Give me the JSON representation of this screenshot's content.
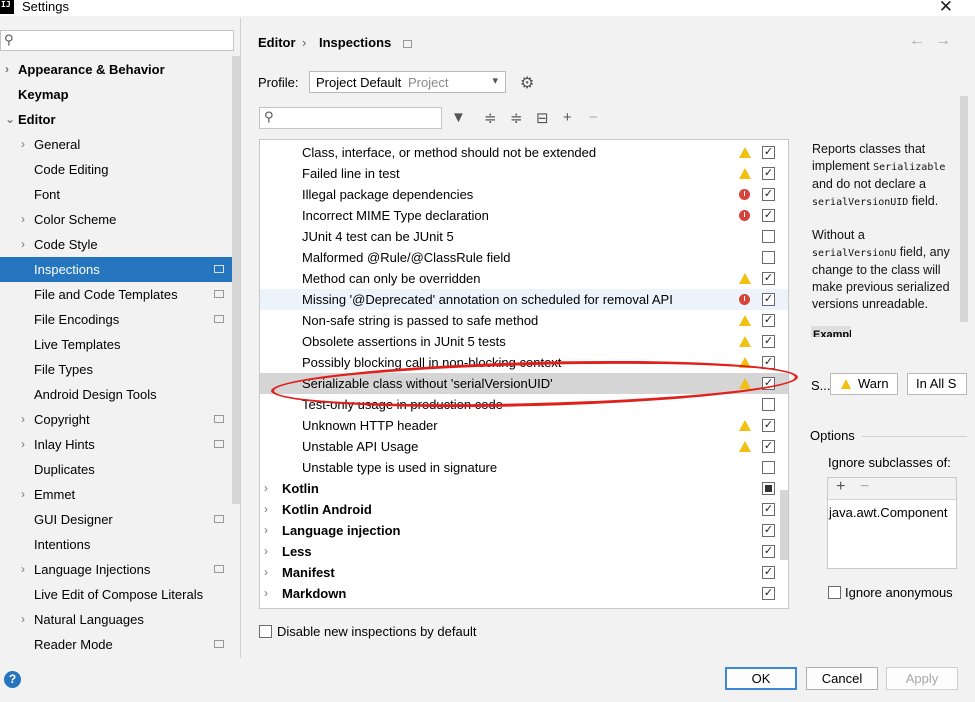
{
  "window": {
    "title": "Settings",
    "app_icon_text": "IJ"
  },
  "sidebar": {
    "search_placeholder": "",
    "items": [
      {
        "label": "Appearance & Behavior",
        "bold": true,
        "chevron": true,
        "indent": 0
      },
      {
        "label": "Keymap",
        "bold": true,
        "chevron": false,
        "indent": 0
      },
      {
        "label": "Editor",
        "bold": true,
        "chevron": true,
        "expanded": true,
        "indent": 0
      },
      {
        "label": "General",
        "chevron": true,
        "indent": 1
      },
      {
        "label": "Code Editing",
        "chevron": false,
        "indent": 1
      },
      {
        "label": "Font",
        "chevron": false,
        "indent": 1
      },
      {
        "label": "Color Scheme",
        "chevron": true,
        "indent": 1
      },
      {
        "label": "Code Style",
        "chevron": true,
        "indent": 1
      },
      {
        "label": "Inspections",
        "chevron": false,
        "indent": 1,
        "selected": true,
        "project_icon": true
      },
      {
        "label": "File and Code Templates",
        "chevron": false,
        "indent": 1,
        "project_icon": true
      },
      {
        "label": "File Encodings",
        "chevron": false,
        "indent": 1,
        "project_icon": true
      },
      {
        "label": "Live Templates",
        "chevron": false,
        "indent": 1
      },
      {
        "label": "File Types",
        "chevron": false,
        "indent": 1
      },
      {
        "label": "Android Design Tools",
        "chevron": false,
        "indent": 1
      },
      {
        "label": "Copyright",
        "chevron": true,
        "indent": 1,
        "project_icon": true
      },
      {
        "label": "Inlay Hints",
        "chevron": true,
        "indent": 1,
        "project_icon": true
      },
      {
        "label": "Duplicates",
        "chevron": false,
        "indent": 1
      },
      {
        "label": "Emmet",
        "chevron": true,
        "indent": 1
      },
      {
        "label": "GUI Designer",
        "chevron": false,
        "indent": 1,
        "project_icon": true
      },
      {
        "label": "Intentions",
        "chevron": false,
        "indent": 1
      },
      {
        "label": "Language Injections",
        "chevron": true,
        "indent": 1,
        "project_icon": true
      },
      {
        "label": "Live Edit of Compose Literals",
        "chevron": false,
        "indent": 1
      },
      {
        "label": "Natural Languages",
        "chevron": true,
        "indent": 1
      },
      {
        "label": "Reader Mode",
        "chevron": false,
        "indent": 1,
        "project_icon": true
      }
    ]
  },
  "header": {
    "breadcrumb": [
      "Editor",
      "Inspections"
    ],
    "separator": "›",
    "back": "←",
    "forward": "→"
  },
  "profile": {
    "label": "Profile:",
    "value": "Project Default",
    "scope": "Project"
  },
  "inspections": [
    {
      "label": "Class, interface, or method should not be extended",
      "severity": "warn",
      "checked": true
    },
    {
      "label": "Failed line in test",
      "severity": "warn",
      "checked": true
    },
    {
      "label": "Illegal package dependencies",
      "severity": "err",
      "checked": true
    },
    {
      "label": "Incorrect MIME Type declaration",
      "severity": "err",
      "checked": true
    },
    {
      "label": "JUnit 4 test can be JUnit 5",
      "severity": "none",
      "checked": false
    },
    {
      "label": "Malformed @Rule/@ClassRule field",
      "severity": "none",
      "checked": false
    },
    {
      "label": "Method can only be overridden",
      "severity": "warn",
      "checked": true
    },
    {
      "label": "Missing '@Deprecated' annotation on scheduled for removal API",
      "severity": "err",
      "checked": true,
      "hover": true
    },
    {
      "label": "Non-safe string is passed to safe method",
      "severity": "warn",
      "checked": true
    },
    {
      "label": "Obsolete assertions in JUnit 5 tests",
      "severity": "warn",
      "checked": true
    },
    {
      "label": "Possibly blocking call in non-blocking context",
      "severity": "warn",
      "checked": true
    },
    {
      "label": "Serializable class without 'serialVersionUID'",
      "severity": "warn",
      "checked": true,
      "selected": true
    },
    {
      "label": "Test-only usage in production code",
      "severity": "none",
      "checked": false
    },
    {
      "label": "Unknown HTTP header",
      "severity": "warn",
      "checked": true
    },
    {
      "label": "Unstable API Usage",
      "severity": "warn",
      "checked": true
    },
    {
      "label": "Unstable type is used in signature",
      "severity": "none",
      "checked": false
    }
  ],
  "groups": [
    {
      "label": "Kotlin",
      "state": "mixed"
    },
    {
      "label": "Kotlin Android",
      "state": "checked"
    },
    {
      "label": "Language injection",
      "state": "checked"
    },
    {
      "label": "Less",
      "state": "checked"
    },
    {
      "label": "Manifest",
      "state": "checked"
    },
    {
      "label": "Markdown",
      "state": "checked"
    }
  ],
  "disable_new": {
    "label": "Disable new inspections by default",
    "checked": false
  },
  "description": {
    "p1_a": "Reports classes that implement ",
    "p1_code1": "Serializable",
    "p1_b": " and do not declare a ",
    "p1_code2": "serialVersionUID",
    "p1_c": " field.",
    "p2_a": "Without a ",
    "p2_code": "serialVersionU",
    "p2_b": " field, any change to the class will make previous serialized versions unreadable.",
    "example": "Example:"
  },
  "severity_row": {
    "label": "S...",
    "severity": "Warn",
    "scope": "In All S"
  },
  "options": {
    "title": "Options",
    "ignore_subclasses": "Ignore subclasses of:",
    "add": "+",
    "remove": "−",
    "entries": [
      "java.awt.Component"
    ],
    "ignore_anonymous": "Ignore anonymous"
  },
  "buttons": {
    "ok": "OK",
    "cancel": "Cancel",
    "apply": "Apply",
    "help": "?"
  }
}
